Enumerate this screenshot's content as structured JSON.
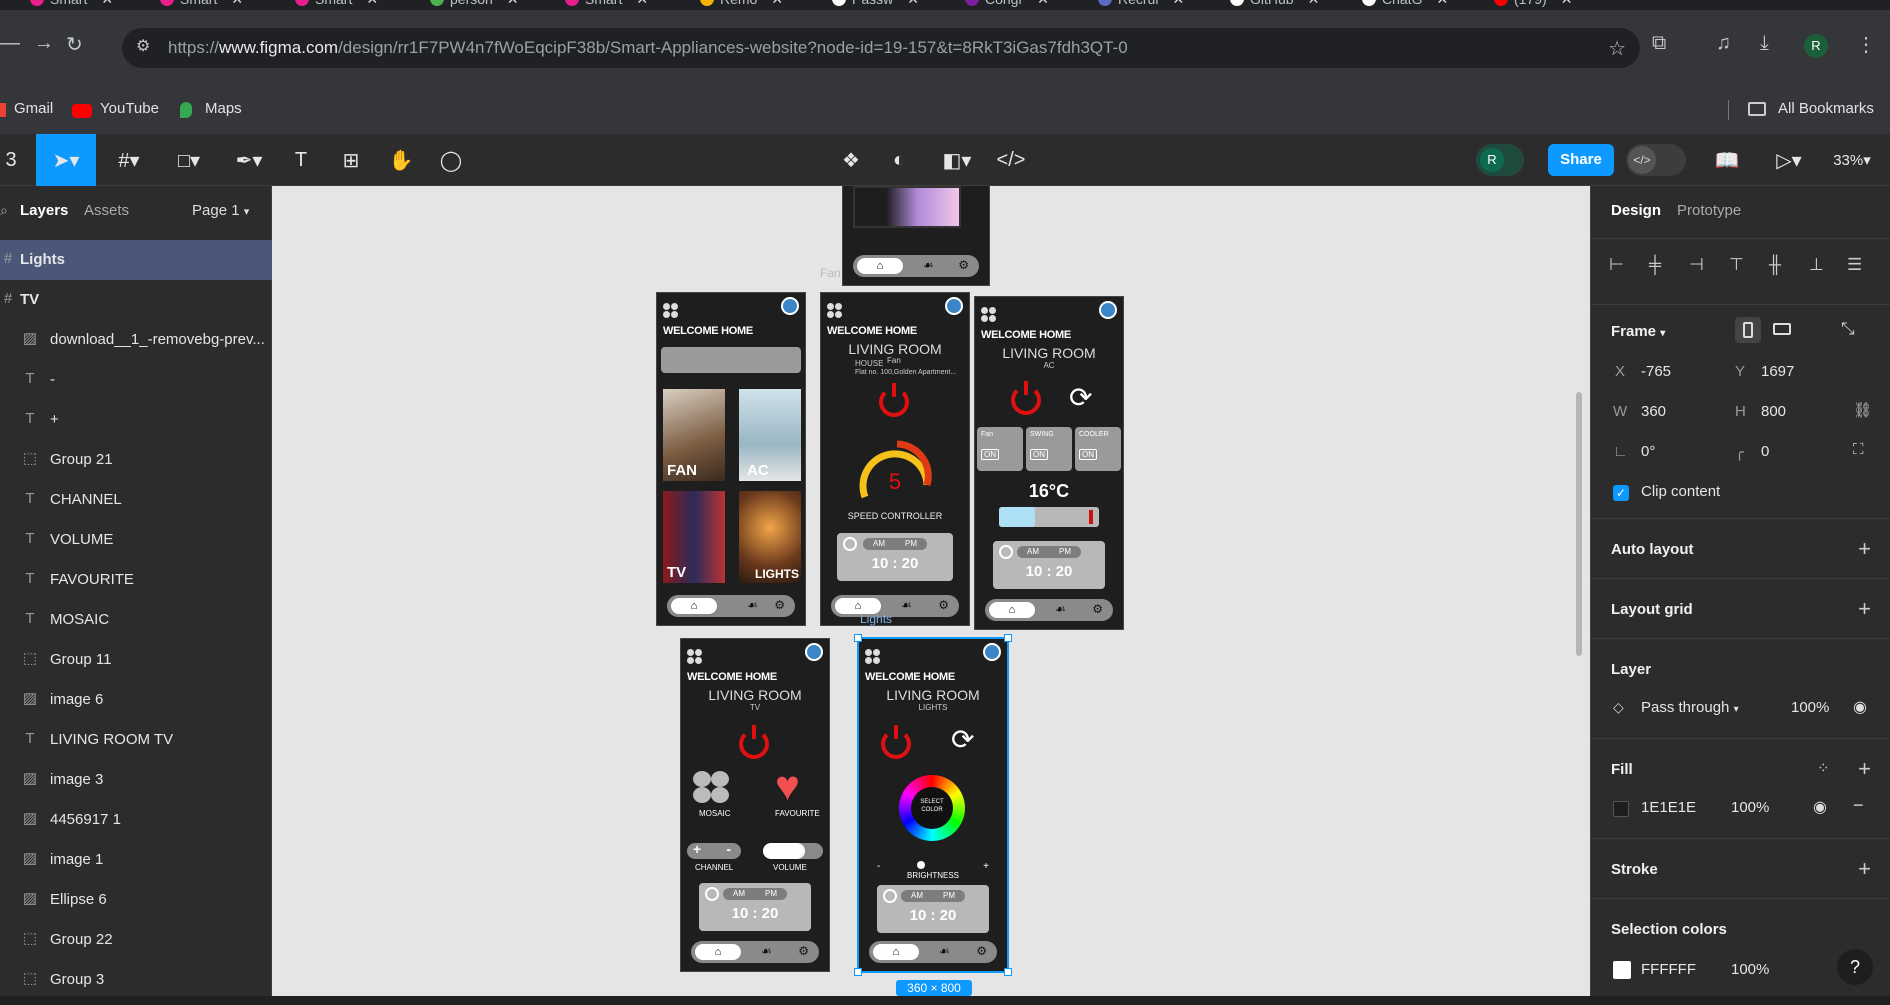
{
  "browser": {
    "tabs": [
      {
        "label": "Smart",
        "color": "#e91e8c"
      },
      {
        "label": "Smart",
        "color": "#e91e8c"
      },
      {
        "label": "Smart",
        "color": "#e91e8c"
      },
      {
        "label": "person",
        "color": "#4caf50"
      },
      {
        "label": "Smart",
        "color": "#e91e8c"
      },
      {
        "label": "Remo",
        "color": "#f4b400"
      },
      {
        "label": "Passw",
        "color": "#ffffff"
      },
      {
        "label": "Congr",
        "color": "#7b1fa2"
      },
      {
        "label": "Recrui",
        "color": "#5c6bc0"
      },
      {
        "label": "GitHub",
        "color": "#ffffff"
      },
      {
        "label": "ChatG",
        "color": "#ffffff"
      },
      {
        "label": "(179)",
        "color": "#ff0000"
      }
    ],
    "url_prefix": "https://",
    "url_domain": "www.figma.com",
    "url_path": "/design/rr1F7PW4n7fWoEqcipF38b/Smart-Appliances-website?node-id=19-157&t=8RkT3iGas7fdh3QT-0",
    "profile_initial": "R",
    "bookmarks": {
      "gmail": "Gmail",
      "youtube": "YouTube",
      "maps": "Maps",
      "all": "All Bookmarks"
    }
  },
  "figma_toolbar": {
    "share_label": "Share",
    "zoom": "33%",
    "avatar_initial": "R"
  },
  "layers_panel": {
    "tab_layers": "Layers",
    "tab_assets": "Assets",
    "page": "Page 1",
    "items": [
      {
        "label": "Lights",
        "type": "frame",
        "selected": true,
        "indent": 0
      },
      {
        "label": "TV",
        "type": "frame",
        "selected": false,
        "indent": 0
      },
      {
        "label": "download__1_-removebg-prev...",
        "type": "image",
        "selected": false,
        "indent": 1
      },
      {
        "label": "-",
        "type": "text",
        "selected": false,
        "indent": 1
      },
      {
        "label": "+",
        "type": "text",
        "selected": false,
        "indent": 1
      },
      {
        "label": "Group 21",
        "type": "group",
        "selected": false,
        "indent": 1
      },
      {
        "label": "CHANNEL",
        "type": "text",
        "selected": false,
        "indent": 1
      },
      {
        "label": "VOLUME",
        "type": "text",
        "selected": false,
        "indent": 1
      },
      {
        "label": "FAVOURITE",
        "type": "text",
        "selected": false,
        "indent": 1
      },
      {
        "label": "MOSAIC",
        "type": "text",
        "selected": false,
        "indent": 1
      },
      {
        "label": "Group 11",
        "type": "group",
        "selected": false,
        "indent": 1
      },
      {
        "label": "image 6",
        "type": "image",
        "selected": false,
        "indent": 1
      },
      {
        "label": "LIVING ROOM TV",
        "type": "text",
        "selected": false,
        "indent": 1
      },
      {
        "label": "image 3",
        "type": "image",
        "selected": false,
        "indent": 1
      },
      {
        "label": "4456917 1",
        "type": "image",
        "selected": false,
        "indent": 1
      },
      {
        "label": "image 1",
        "type": "image",
        "selected": false,
        "indent": 1
      },
      {
        "label": "Ellipse 6",
        "type": "image",
        "selected": false,
        "indent": 1
      },
      {
        "label": "Group 22",
        "type": "group",
        "selected": false,
        "indent": 1
      },
      {
        "label": "Group 3",
        "type": "group",
        "selected": false,
        "indent": 1
      }
    ]
  },
  "canvas": {
    "frame_label_fan": "Fan",
    "frame_label_lights": "Lights",
    "size_badge": "360 × 800",
    "home": {
      "welcome": "WELCOME HOME",
      "tiles": [
        "FAN",
        "AC",
        "TV",
        "LIGHTS"
      ]
    },
    "fan": {
      "welcome": "WELCOME HOME",
      "room": "LIVING ROOM",
      "house_label": "HOUSE",
      "device": "Fan",
      "address": "Flat no. 100,Golden Apartment...",
      "speed": "5",
      "speed_label": "SPEED CONTROLLER",
      "am": "AM",
      "pm": "PM",
      "time": "10 : 20"
    },
    "ac": {
      "welcome": "WELCOME HOME",
      "room": "LIVING ROOM",
      "device": "AC",
      "modes": [
        {
          "label": "Fan",
          "state": "ON"
        },
        {
          "label": "SWING",
          "state": "ON"
        },
        {
          "label": "COOLER",
          "state": "ON"
        }
      ],
      "temp": "16°C",
      "am": "AM",
      "pm": "PM",
      "time": "10 : 20"
    },
    "tv": {
      "welcome": "WELCOME HOME",
      "room": "LIVING ROOM",
      "device": "TV",
      "mosaic": "MOSAIC",
      "favourite": "FAVOURITE",
      "plus": "+",
      "minus": "-",
      "channel": "CHANNEL",
      "volume": "VOLUME",
      "am": "AM",
      "pm": "PM",
      "time": "10 : 20"
    },
    "lights": {
      "welcome": "WELCOME HOME",
      "room": "LIVING ROOM",
      "device": "LIGHTS",
      "select": "SELECT",
      "color": "COLOR",
      "minus": "-",
      "plus": "+",
      "brightness": "BRIGHTNESS",
      "am": "AM",
      "pm": "PM",
      "time": "10 : 20"
    }
  },
  "design_panel": {
    "tab_design": "Design",
    "tab_prototype": "Prototype",
    "frame_label": "Frame",
    "x_label": "X",
    "x_value": "-765",
    "y_label": "Y",
    "y_value": "1697",
    "w_label": "W",
    "w_value": "360",
    "h_label": "H",
    "h_value": "800",
    "rotation": "0°",
    "radius": "0",
    "clip_content": "Clip content",
    "auto_layout": "Auto layout",
    "layout_grid": "Layout grid",
    "layer": "Layer",
    "blend": "Pass through",
    "layer_opacity": "100%",
    "fill": "Fill",
    "fill_hex": "1E1E1E",
    "fill_opacity": "100%",
    "stroke": "Stroke",
    "selection_colors": "Selection colors",
    "sel_hex": "FFFFFF",
    "sel_opacity": "100%",
    "help": "?"
  },
  "colors": {
    "accent": "#0d99ff",
    "selected_layer": "#4a5778",
    "power_red": "#e01010"
  }
}
